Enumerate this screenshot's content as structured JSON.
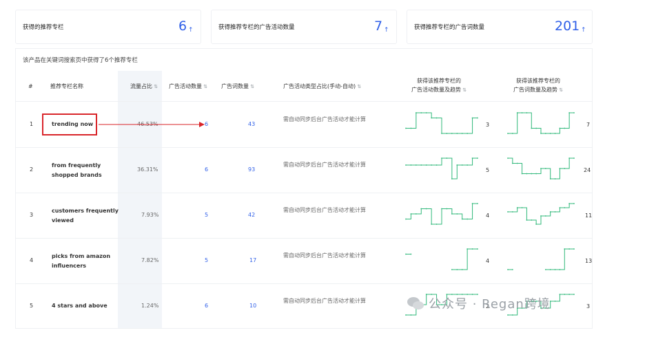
{
  "cards": [
    {
      "label": "获得的推荐专栏",
      "value": "6",
      "arrow": "↑"
    },
    {
      "label": "获得推荐专栏的广告活动数量",
      "value": "7",
      "arrow": "↑"
    },
    {
      "label": "获得推荐专栏的广告词数量",
      "value": "201",
      "arrow": "↑"
    }
  ],
  "caption": "该产品在关键词搜索页中获得了6个推荐专栏",
  "headers": {
    "index": "#",
    "name": "推荐专栏名称",
    "traffic": "流量占比",
    "campaigns": "广告活动数量",
    "keywords": "广告词数量",
    "type": "广告活动类型占比(手动-自动)",
    "campaign_trend_1": "获得该推荐专栏的",
    "campaign_trend_2": "广告活动数量及趋势",
    "keyword_trend_1": "获得该推荐专栏的",
    "keyword_trend_2": "广告词数量及趋势"
  },
  "rows": [
    {
      "index": "1",
      "name_1": "trending now",
      "name_2": "",
      "traffic": "46.53%",
      "campaigns": "6",
      "keywords": "43",
      "type": "需自动同步后台广告活动才能计算",
      "campaign_trend_value": "3",
      "keyword_trend_value": "7",
      "campaign_trend": [
        1,
        1,
        4,
        4,
        4,
        3,
        3,
        0,
        0,
        0,
        0,
        0,
        0,
        3,
        3
      ],
      "keyword_trend": [
        0,
        0,
        4,
        4,
        4,
        1,
        1,
        0,
        0,
        0,
        0,
        1,
        1,
        4,
        4
      ]
    },
    {
      "index": "2",
      "name_1": "from frequently",
      "name_2": "shopped brands",
      "traffic": "36.31%",
      "campaigns": "6",
      "keywords": "93",
      "type": "需自动同步后台广告活动才能计算",
      "campaign_trend_value": "5",
      "keyword_trend_value": "24",
      "campaign_trend": [
        2,
        2,
        2,
        2,
        2,
        2,
        2,
        3,
        3,
        0,
        2,
        2,
        2,
        3,
        3
      ],
      "keyword_trend": [
        3,
        2,
        2,
        0,
        0,
        0,
        0,
        1,
        1,
        -1,
        -1,
        1,
        1,
        3,
        3
      ]
    },
    {
      "index": "3",
      "name_1": "customers frequently",
      "name_2": "viewed",
      "traffic": "7.93%",
      "campaigns": "5",
      "keywords": "42",
      "type": "需自动同步后台广告活动才能计算",
      "campaign_trend_value": "4",
      "keyword_trend_value": "11",
      "campaign_trend": [
        1,
        2,
        2,
        3,
        3,
        0,
        0,
        3,
        3,
        2,
        2,
        1,
        1,
        4,
        4
      ],
      "keyword_trend": [
        2,
        2,
        3,
        3,
        0,
        0,
        -1,
        1,
        1,
        2,
        2,
        3,
        3,
        4,
        4
      ]
    },
    {
      "index": "4",
      "name_1": "picks from amazon",
      "name_2": "influencers",
      "traffic": "7.82%",
      "campaigns": "5",
      "keywords": "17",
      "type": "需自动同步后台广告活动才能计算",
      "campaign_trend_value": "4",
      "keyword_trend_value": "13",
      "campaign_trend": [
        3,
        3,
        null,
        null,
        null,
        null,
        null,
        null,
        null,
        0,
        0,
        0,
        4,
        4,
        4
      ],
      "keyword_trend": [
        0,
        0,
        null,
        null,
        null,
        null,
        null,
        null,
        0,
        0,
        0,
        0,
        4,
        4,
        4
      ]
    },
    {
      "index": "5",
      "name_1": "4 stars and above",
      "name_2": "",
      "traffic": "1.24%",
      "campaigns": "6",
      "keywords": "10",
      "type": "需自动同步后台广告活动才能计算",
      "campaign_trend_value": "2",
      "keyword_trend_value": "3",
      "campaign_trend": [
        0,
        0,
        1,
        1,
        2,
        2,
        1,
        1,
        2,
        2,
        2,
        2,
        2,
        2,
        2
      ],
      "keyword_trend": [
        0,
        0,
        1,
        1,
        2,
        2,
        2,
        1,
        1,
        2,
        2,
        3,
        3,
        3,
        3
      ]
    }
  ],
  "watermark": "公众号 · Regan跨境",
  "colors": {
    "accent": "#2f5fe8",
    "trend": "#2fb87a",
    "highlight": "#d9252a"
  }
}
